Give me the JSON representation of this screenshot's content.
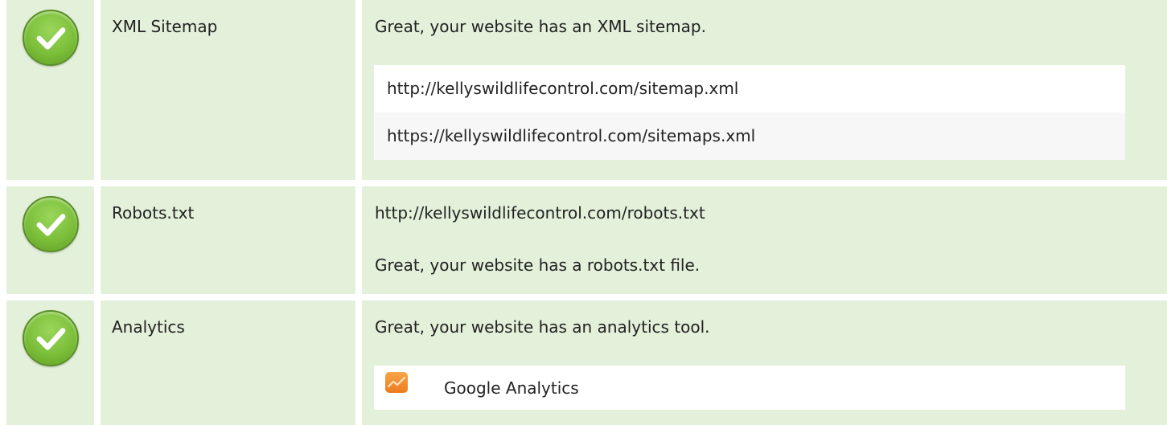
{
  "colors": {
    "row_background": "#e3f0da",
    "pass": "#7cbf3a",
    "analytics_brand": "#ec7b1e"
  },
  "checks": [
    {
      "status": "pass",
      "icon": "check-circle-icon",
      "label": "XML Sitemap",
      "message": "Great, your website has an XML sitemap.",
      "urls": [
        "http://kellyswildlifecontrol.com/sitemap.xml",
        "https://kellyswildlifecontrol.com/sitemaps.xml"
      ]
    },
    {
      "status": "pass",
      "icon": "check-circle-icon",
      "label": "Robots.txt",
      "url": "http://kellyswildlifecontrol.com/robots.txt",
      "message": "Great, your website has a robots.txt file."
    },
    {
      "status": "pass",
      "icon": "check-circle-icon",
      "label": "Analytics",
      "message": "Great, your website has an analytics tool.",
      "tools": [
        {
          "icon": "google-analytics-icon",
          "name": "Google Analytics"
        }
      ]
    }
  ]
}
